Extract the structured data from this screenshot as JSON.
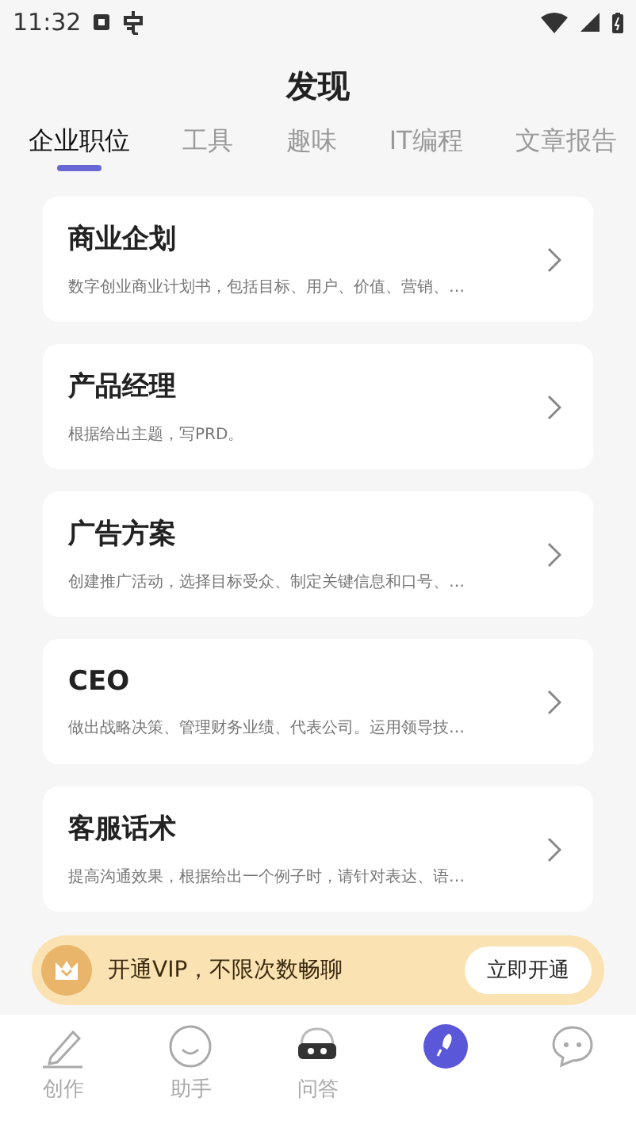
{
  "status_bar": {
    "time": "11:32"
  },
  "title": "发现",
  "tabs": [
    {
      "label": "企业职位",
      "selected": true
    },
    {
      "label": "工具",
      "selected": false
    },
    {
      "label": "趣味",
      "selected": false
    },
    {
      "label": "IT编程",
      "selected": false
    },
    {
      "label": "文章报告",
      "selected": false
    }
  ],
  "cards": [
    {
      "title": "商业企划",
      "description": "数字创业商业计划书，包括目标、用户、价值、营销、…"
    },
    {
      "title": "产品经理",
      "description": "根据给出主题，写PRD。"
    },
    {
      "title": "广告方案",
      "description": "创建推广活动，选择目标受众、制定关键信息和口号、…"
    },
    {
      "title": "CEO",
      "description": "做出战略决策、管理财务业绩、代表公司。运用领导技…"
    },
    {
      "title": "客服话术",
      "description": "提高沟通效果，根据给出一个例子时，请针对表达、语…"
    }
  ],
  "vip_banner": {
    "text": "开通VIP，不限次数畅聊",
    "button": "立即开通"
  },
  "bottom_nav": [
    {
      "kind": "pencil",
      "label": "创作",
      "selected": false
    },
    {
      "kind": "smile",
      "label": "助手",
      "selected": false
    },
    {
      "kind": "robot",
      "label": "问答",
      "selected": false
    },
    {
      "kind": "rocket",
      "selected": true
    },
    {
      "kind": "chat",
      "selected": false
    }
  ]
}
